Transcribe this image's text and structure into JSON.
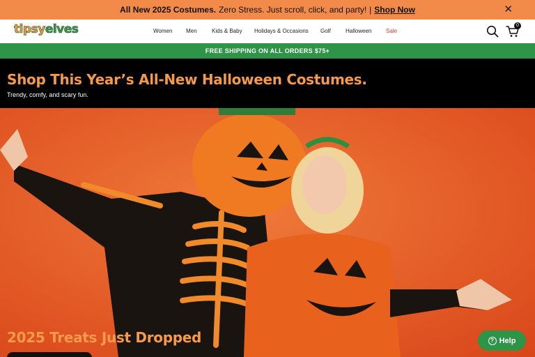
{
  "announcement": {
    "bold": "All New 2025 Costumes.",
    "text": "Zero Stress. Just scroll, click, and party!",
    "separator": "|",
    "link": "Shop Now",
    "close": "✕"
  },
  "logo": {
    "part1": "tipsy",
    "part2": "elves"
  },
  "nav": {
    "items": [
      "Women",
      "Men",
      "Kids & Baby",
      "Holidays & Occasions",
      "Golf",
      "Halloween",
      "Sale"
    ],
    "cart_count": "0"
  },
  "shipping_banner": "FREE SHIPPING ON ALL ORDERS $75+",
  "hero": {
    "title": "Shop This Year’s All-New Halloween Costumes.",
    "subtitle": "Trendy, comfy, and scary fun.",
    "promo": "2025 Treats Just Dropped"
  },
  "help": {
    "label": "Help",
    "icon": "?"
  },
  "colors": {
    "announcement_bg": "#f28a4a",
    "shipping_bg": "#2e9447",
    "hero_title": "#f59a4c",
    "sale": "#d23a2a",
    "help_bg": "#2e9447"
  }
}
